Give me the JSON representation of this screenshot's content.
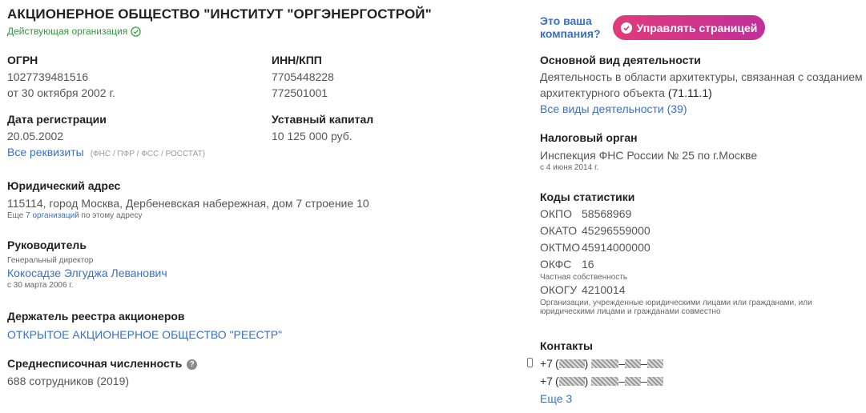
{
  "company": {
    "title": "АКЦИОНЕРНОЕ ОБЩЕСТВО \"ИНСТИТУТ \"ОРГЭНЕРГОСТРОЙ\"",
    "status": "Действующая организация"
  },
  "ogrn": {
    "label": "ОГРН",
    "value": "1027739481516",
    "date": "от 30 октября 2002 г."
  },
  "inn_kpp": {
    "label": "ИНН/КПП",
    "inn": "7705448228",
    "kpp": "772501001"
  },
  "registration": {
    "label": "Дата регистрации",
    "value": "20.05.2002"
  },
  "capital": {
    "label": "Уставный капитал",
    "value": "10 125 000 руб."
  },
  "requisites": {
    "link": "Все реквизиты",
    "note": "(ФНС / ПФР / ФСС / РОССТАТ)"
  },
  "address": {
    "label": "Юридический адрес",
    "value": "115114, город Москва, Дербеневская набережная, дом 7 строение 10",
    "more_prefix": "Еще",
    "more_link": "7 организаций",
    "more_suffix": "по этому адресу"
  },
  "director": {
    "label": "Руководитель",
    "role": "Генеральный директор",
    "name": "Кокосадзе Элгуджа Леванович",
    "since": "с 30 марта 2006 г."
  },
  "registry": {
    "label": "Держатель реестра акционеров",
    "value": "ОТКРЫТОЕ АКЦИОНЕРНОЕ ОБЩЕСТВО \"РЕЕСТР\""
  },
  "headcount": {
    "label": "Среднесписочная численность",
    "help": "?",
    "value": "688 сотрудников (2019)"
  },
  "owner_prompt": {
    "line1": "Это ваша",
    "line2": "компания?"
  },
  "manage_button": {
    "label": "Управлять страницей",
    "icon": "shield-check-icon",
    "color_from": "#e03a7a",
    "color_to": "#c0309a"
  },
  "activity": {
    "label": "Основной вид деятельности",
    "line1": "Деятельность в области архитектуры, связанная с созданием",
    "line2": "архитектурного объекта",
    "code": "(71.11.1)",
    "all_link": "Все виды деятельности (39)"
  },
  "tax": {
    "label": "Налоговый орган",
    "value": "Инспекция ФНС России № 25 по г.Москве",
    "since": "с 4 июня 2014 г."
  },
  "stats": {
    "label": "Коды статистики",
    "okpo": {
      "k": "ОКПО",
      "v": "58568969"
    },
    "okato": {
      "k": "ОКАТО",
      "v": "45296559000"
    },
    "oktmo": {
      "k": "ОКТМО",
      "v": "45914000000"
    },
    "okfs": {
      "k": "ОКФС",
      "v": "16",
      "note": "Частная собственность"
    },
    "okogu": {
      "k": "ОКОГУ",
      "v": "4210014",
      "note1": "Организации, учрежденные юридическими лицами или гражданами, или",
      "note2": "юридическими лицами и гражданами совместно"
    }
  },
  "contacts": {
    "label": "Контакты",
    "phone1_prefix": "+7",
    "phone2_prefix": "+7",
    "more": "Еще 3"
  },
  "colors": {
    "link": "#3a6fc4",
    "status_green": "#2e9a3a"
  }
}
